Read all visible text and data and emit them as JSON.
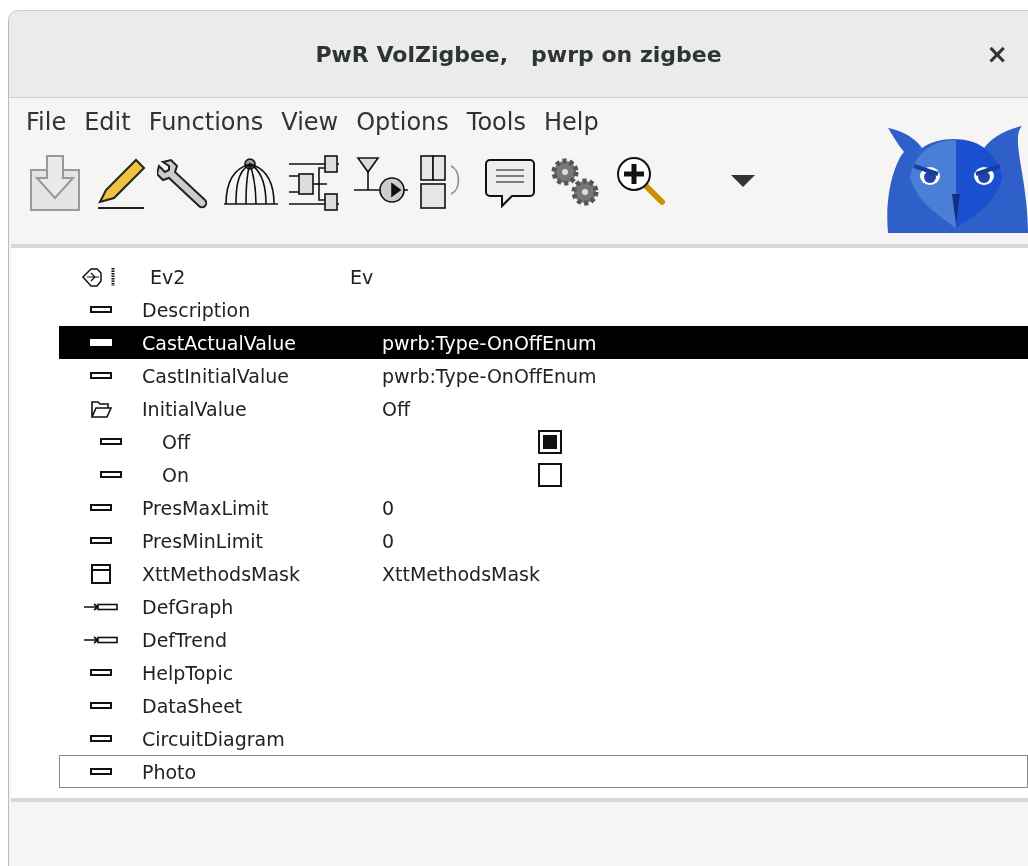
{
  "window": {
    "title": "PwR VolZigbee,   pwrp on zigbee",
    "close": "×"
  },
  "menu": [
    "File",
    "Edit",
    "Functions",
    "View",
    "Options",
    "Tools",
    "Help"
  ],
  "tree": [
    {
      "kind": "object",
      "name": "Ev2",
      "value": "Ev",
      "selected": false,
      "focused": false
    },
    {
      "kind": "attr",
      "name": "Description",
      "selected": false,
      "focused": false
    },
    {
      "kind": "attr",
      "name": "CastActualValue",
      "value": "pwrb:Type-OnOffEnum",
      "selected": true,
      "focused": false
    },
    {
      "kind": "attr",
      "name": "CastInitialValue",
      "value": "pwrb:Type-OnOffEnum",
      "selected": false,
      "focused": false
    },
    {
      "kind": "folder",
      "name": "InitialValue",
      "value": "Off",
      "selected": false,
      "focused": false,
      "children": [
        {
          "kind": "enum",
          "name": "Off",
          "checked": true
        },
        {
          "kind": "enum",
          "name": "On",
          "checked": false
        }
      ]
    },
    {
      "kind": "attr",
      "name": "PresMaxLimit",
      "value": "0",
      "selected": false,
      "focused": false
    },
    {
      "kind": "attr",
      "name": "PresMinLimit",
      "value": "0",
      "selected": false,
      "focused": false
    },
    {
      "kind": "mask",
      "name": "XttMethodsMask",
      "value": "XttMethodsMask",
      "selected": false,
      "focused": false
    },
    {
      "kind": "link",
      "name": "DefGraph",
      "selected": false,
      "focused": false
    },
    {
      "kind": "link",
      "name": "DefTrend",
      "selected": false,
      "focused": false
    },
    {
      "kind": "attr",
      "name": "HelpTopic",
      "selected": false,
      "focused": false
    },
    {
      "kind": "attr",
      "name": "DataSheet",
      "selected": false,
      "focused": false
    },
    {
      "kind": "attr",
      "name": "CircuitDiagram",
      "selected": false,
      "focused": false
    },
    {
      "kind": "attr",
      "name": "Photo",
      "selected": false,
      "focused": true
    }
  ]
}
